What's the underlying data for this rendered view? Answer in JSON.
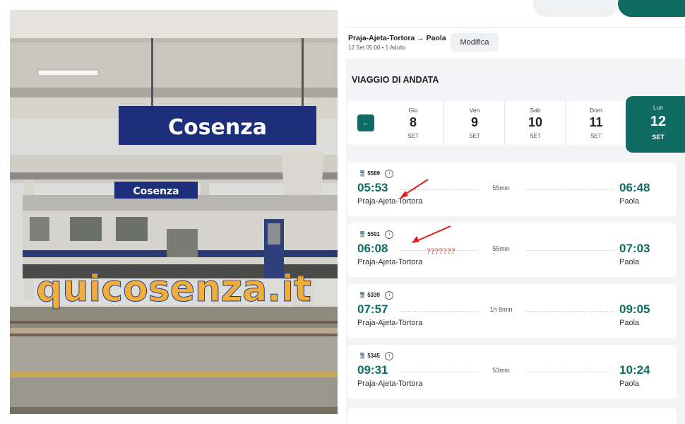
{
  "photo": {
    "sign_main": "Cosenza",
    "sign_small": "Cosenza",
    "watermark": "quicosenza.it",
    "watermark_colors": [
      "#f5a623",
      "#1f3d8a"
    ]
  },
  "app": {
    "route_title": "Praja-Ajeta-Tortora → Paola",
    "route_sub": "12 Set 05:00 • 1 Adulto",
    "edit_label": "Modifica",
    "section_title": "VIAGGIO DI ANDATA",
    "accent_color": "#0f6b63",
    "back_icon_glyph": "←",
    "dates": [
      {
        "weekday": "Gio",
        "day": "8",
        "month": "SET"
      },
      {
        "weekday": "Ven",
        "day": "9",
        "month": "SET"
      },
      {
        "weekday": "Sab",
        "day": "10",
        "month": "SET"
      },
      {
        "weekday": "Dom",
        "day": "11",
        "month": "SET"
      },
      {
        "weekday": "Lun",
        "day": "12",
        "month": "SET",
        "selected": true
      }
    ],
    "trains": [
      {
        "number": "5589",
        "dep_time": "05:53",
        "dep_station": "Praja-Ajeta-Tortora",
        "duration": "55min",
        "arr_time": "06:48",
        "arr_station": "Paola"
      },
      {
        "number": "5591",
        "dep_time": "06:08",
        "dep_station": "Praja-Ajeta-Tortora",
        "duration": "55min",
        "arr_time": "07:03",
        "arr_station": "Paola",
        "annotation": "???????"
      },
      {
        "number": "5339",
        "dep_time": "07:57",
        "dep_station": "Praja-Ajeta-Tortora",
        "duration": "1h 8min",
        "arr_time": "09:05",
        "arr_station": "Paola"
      },
      {
        "number": "5345",
        "dep_time": "09:31",
        "dep_station": "Praja-Ajeta-Tortora",
        "duration": "53min",
        "arr_time": "10:24",
        "arr_station": "Paola"
      }
    ],
    "icons": {
      "train": "train-icon",
      "info": "info-icon",
      "back": "arrow-left-icon"
    },
    "annotation_color": "#e41e1e"
  }
}
